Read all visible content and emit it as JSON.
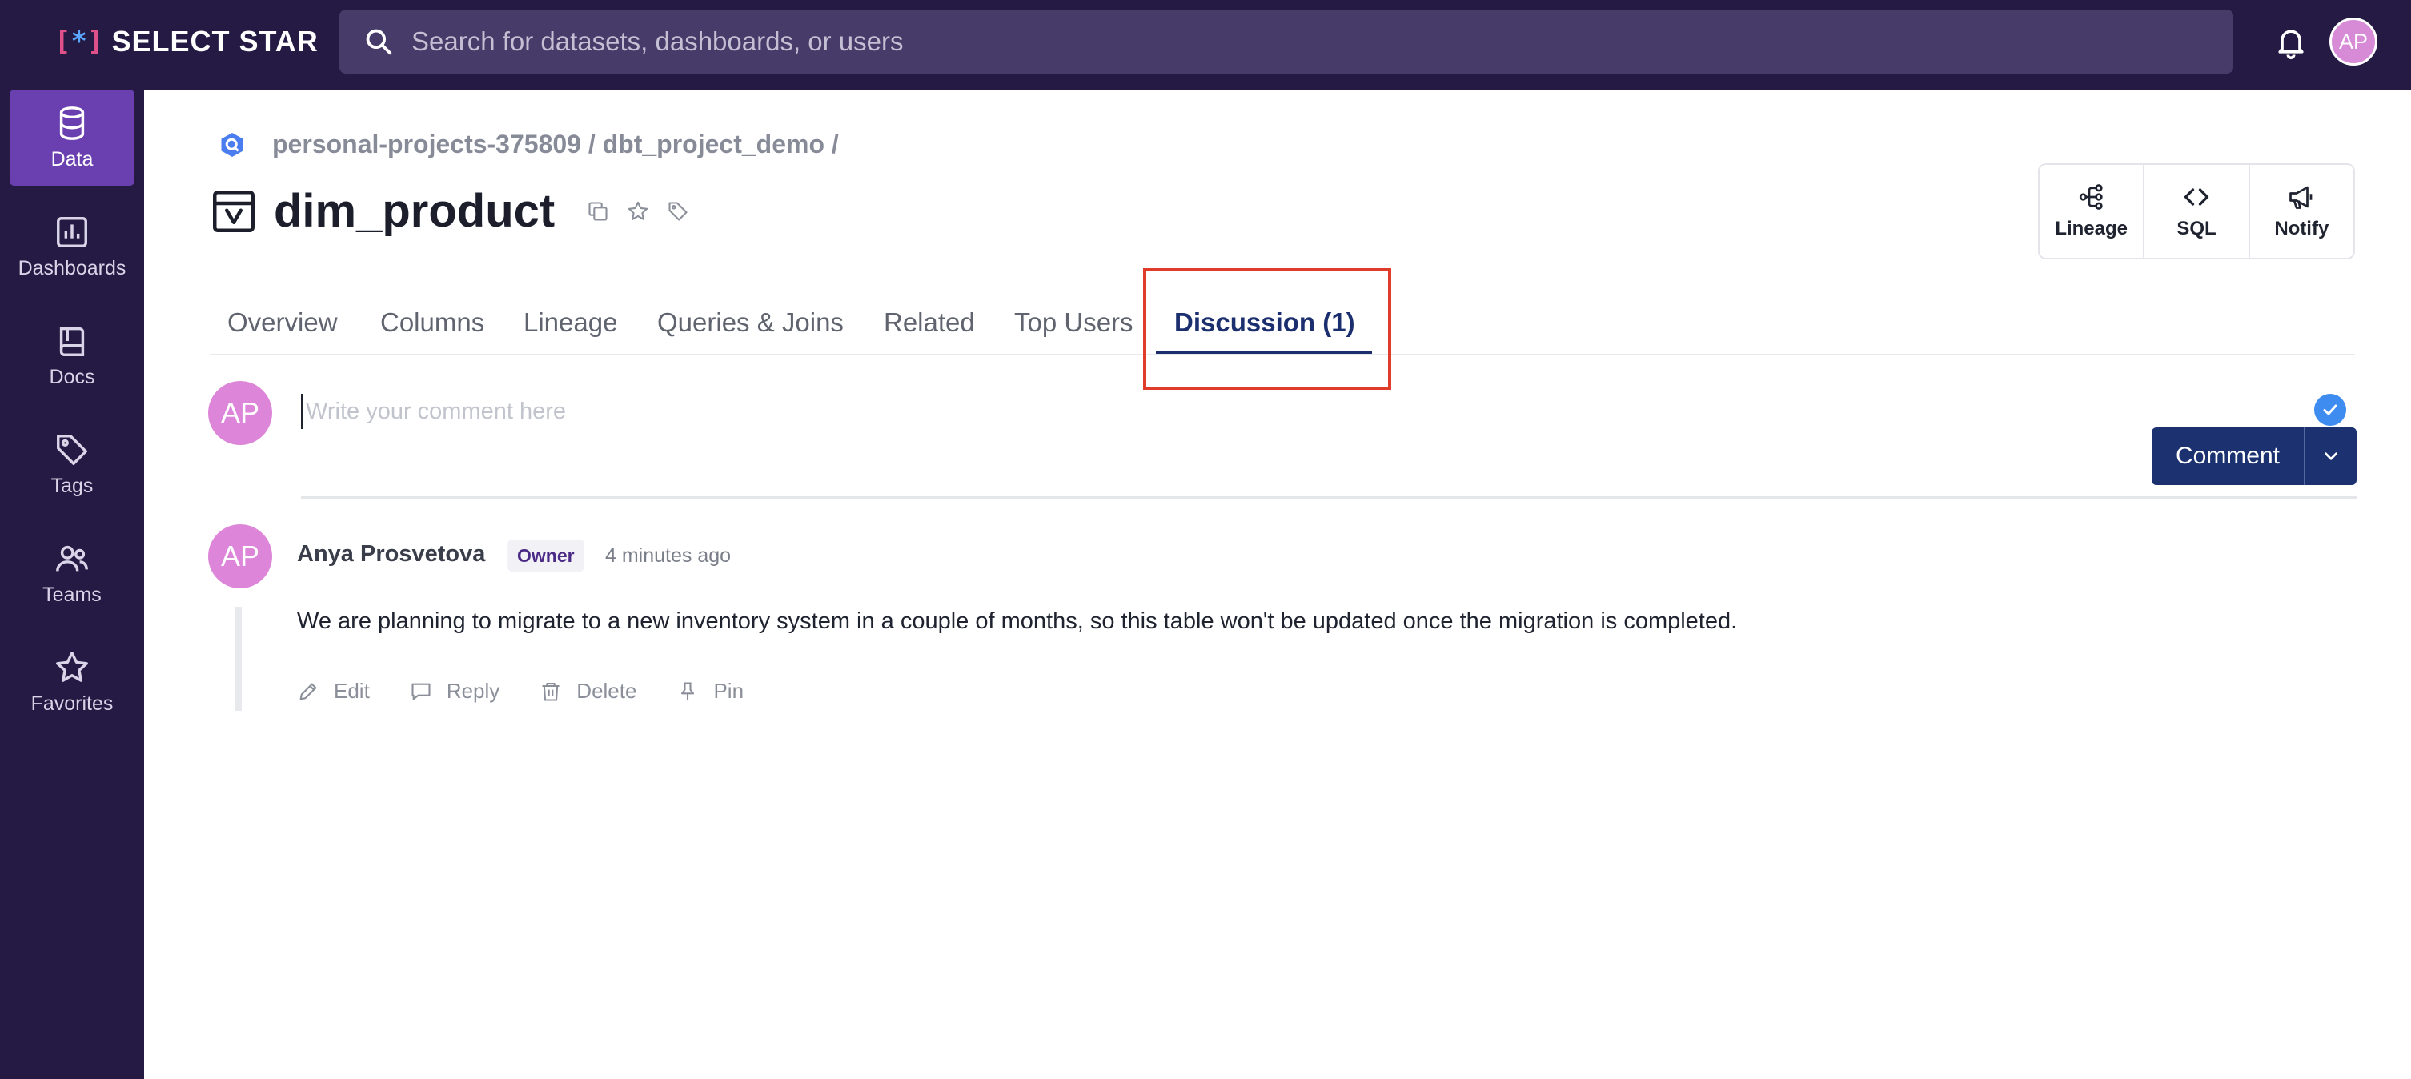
{
  "app": {
    "logo_mark_left": "[",
    "logo_mark_star": "*",
    "logo_mark_right": "]",
    "logo_text": "SELECT STAR",
    "search_placeholder": "Search for datasets, dashboards, or users",
    "user_initials": "AP"
  },
  "sidebar": {
    "items": [
      {
        "label": "Data",
        "icon": "database-icon",
        "active": true
      },
      {
        "label": "Dashboards",
        "icon": "bar-chart-icon",
        "active": false
      },
      {
        "label": "Docs",
        "icon": "book-icon",
        "active": false
      },
      {
        "label": "Tags",
        "icon": "tag-icon",
        "active": false
      },
      {
        "label": "Teams",
        "icon": "users-icon",
        "active": false
      },
      {
        "label": "Favorites",
        "icon": "star-icon",
        "active": false
      }
    ]
  },
  "page": {
    "breadcrumb": "personal-projects-375809 / dbt_project_demo /",
    "breadcrumb_icon": "bigquery-icon",
    "title": "dim_product",
    "title_icon": "table-view-icon",
    "title_actions": [
      "copy-icon",
      "star-icon",
      "tag-icon"
    ]
  },
  "actions": [
    {
      "label": "Lineage",
      "icon": "lineage-icon"
    },
    {
      "label": "SQL",
      "icon": "code-icon"
    },
    {
      "label": "Notify",
      "icon": "megaphone-icon"
    }
  ],
  "tabs": [
    {
      "label": "Overview",
      "active": false
    },
    {
      "label": "Columns",
      "active": false
    },
    {
      "label": "Lineage",
      "active": false
    },
    {
      "label": "Queries & Joins",
      "active": false
    },
    {
      "label": "Related",
      "active": false
    },
    {
      "label": "Top Users",
      "active": false
    },
    {
      "label": "Discussion (1)",
      "active": true
    }
  ],
  "composer": {
    "avatar_initials": "AP",
    "placeholder": "Write your comment here",
    "value": "",
    "submit_label": "Comment"
  },
  "comments": [
    {
      "avatar_initials": "AP",
      "author": "Anya Prosvetova",
      "badge": "Owner",
      "time": "4 minutes ago",
      "text": "We are planning to migrate to a new inventory system in a couple of months, so this table won't be updated once the migration is completed.",
      "actions": [
        "Edit",
        "Reply",
        "Delete",
        "Pin"
      ]
    }
  ],
  "colors": {
    "nav_bg": "#241a43",
    "active_nav": "#6a3fb0",
    "primary": "#1b3170",
    "highlight_box": "#e03c2c",
    "avatar": "#dd86d9"
  }
}
